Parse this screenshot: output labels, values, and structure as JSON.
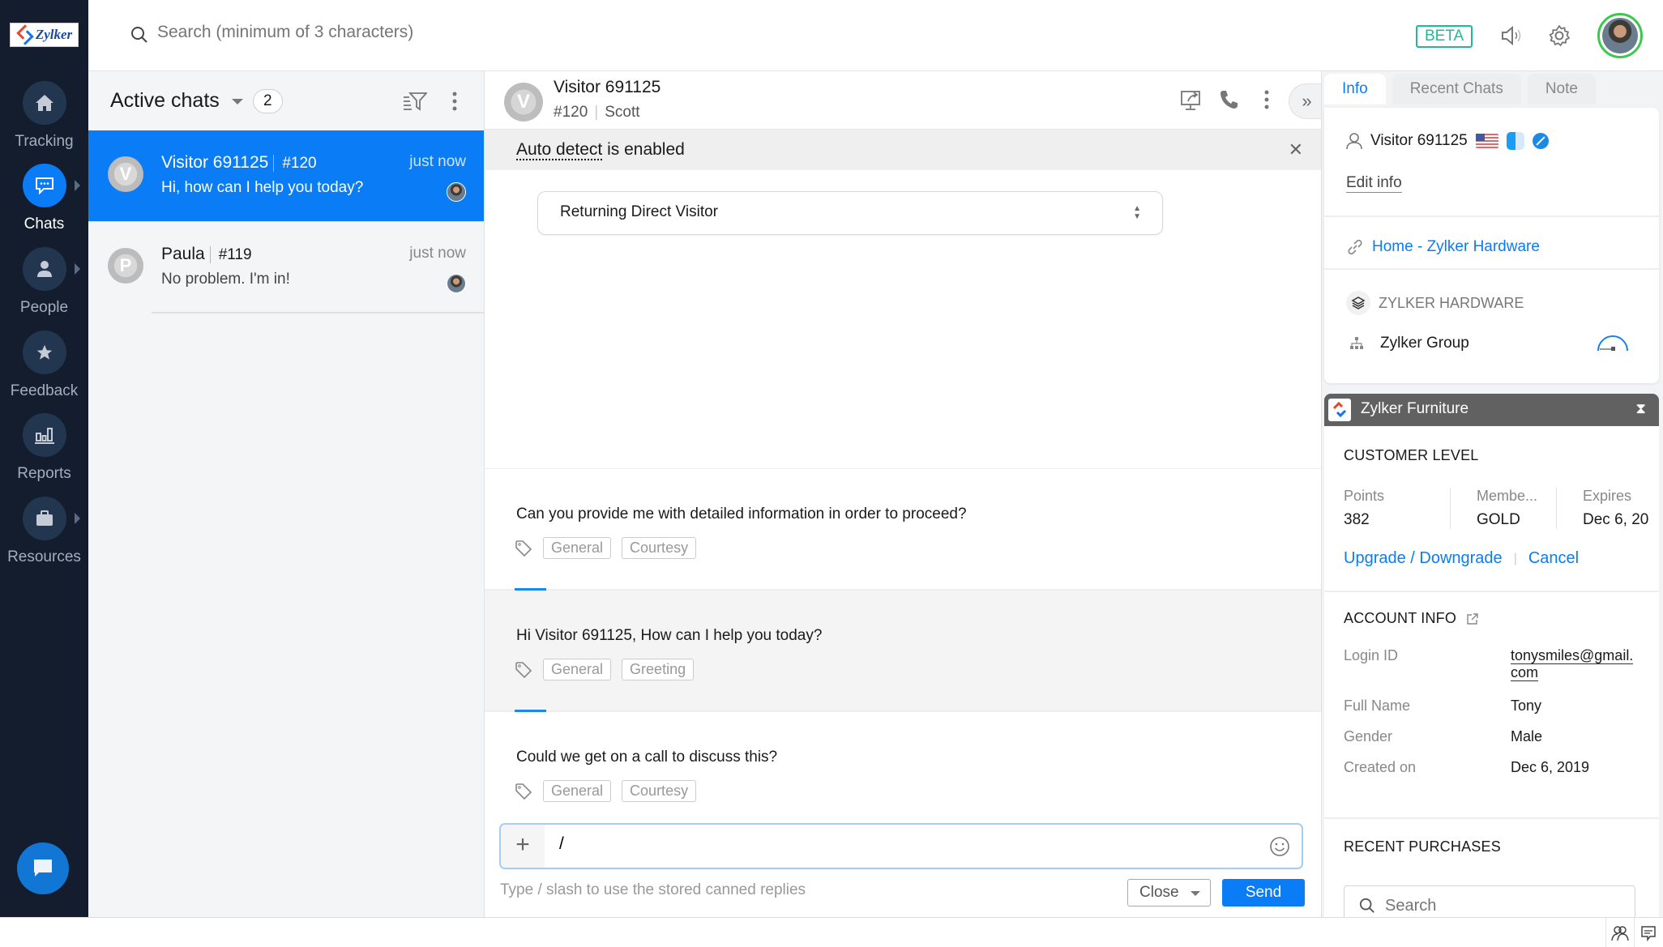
{
  "app": {
    "brand": "Zylker"
  },
  "rail": {
    "items": [
      {
        "label": "Tracking",
        "icon": "home-icon",
        "active": false,
        "has_arrow": false
      },
      {
        "label": "Chats",
        "icon": "chat-bubble-icon",
        "active": true,
        "has_arrow": true
      },
      {
        "label": "People",
        "icon": "person-icon",
        "active": false,
        "has_arrow": true
      },
      {
        "label": "Feedback",
        "icon": "star-icon",
        "active": false,
        "has_arrow": false
      },
      {
        "label": "Reports",
        "icon": "bar-chart-icon",
        "active": false,
        "has_arrow": false
      },
      {
        "label": "Resources",
        "icon": "briefcase-icon",
        "active": false,
        "has_arrow": true
      }
    ]
  },
  "topbar": {
    "search_placeholder": "Search (minimum of 3 characters)",
    "beta_label": "BETA"
  },
  "chat_list": {
    "title": "Active chats",
    "count": "2",
    "items": [
      {
        "initial": "V",
        "name": "Visitor 691125",
        "id": "#120",
        "time": "just now",
        "message": "Hi, how can I help you today?",
        "selected": true
      },
      {
        "initial": "P",
        "name": "Paula",
        "id": "#119",
        "time": "just now",
        "message": "No problem. I'm in!",
        "selected": false
      }
    ]
  },
  "conversation": {
    "visitor_initial": "V",
    "visitor_name": "Visitor 691125",
    "chat_id": "#120",
    "agent": "Scott",
    "notice_link": "Auto detect",
    "notice_rest": " is enabled",
    "visitor_type": "Returning Direct Visitor",
    "expand_label": "»",
    "canned_replies": [
      {
        "text": "Can you provide me with detailed information in order to proceed?",
        "tags": [
          "General",
          "Courtesy"
        ],
        "highlighted": false
      },
      {
        "text": "Hi Visitor 691125, How can I help you today?",
        "tags": [
          "General",
          "Greeting"
        ],
        "highlighted": true
      },
      {
        "text": "Could we get on a call to discuss this?",
        "tags": [
          "General",
          "Courtesy"
        ],
        "highlighted": false
      }
    ],
    "composer_value": "/",
    "composer_hint": "Type / slash to use the stored canned replies",
    "close_label": "Close",
    "send_label": "Send"
  },
  "info_panel": {
    "tabs": [
      {
        "label": "Info",
        "active": true
      },
      {
        "label": "Recent Chats",
        "active": false
      },
      {
        "label": "Note",
        "active": false
      }
    ],
    "visitor_name": "Visitor 691125",
    "edit_label": "Edit info",
    "page_link": "Home - Zylker Hardware",
    "brand": "ZYLKER HARDWARE",
    "department": "Zylker Group",
    "widget": {
      "title": "Zylker Furniture",
      "customer_level_label": "CUSTOMER LEVEL",
      "stats": [
        {
          "label": "Points",
          "value": "382"
        },
        {
          "label": "Membe...",
          "value": "GOLD"
        },
        {
          "label": "Expires",
          "value": "Dec 6, 20"
        }
      ],
      "upgrade_label": "Upgrade / Downgrade",
      "cancel_label": "Cancel",
      "account_info_label": "ACCOUNT INFO",
      "account": [
        {
          "label": "Login ID",
          "value": "tonysmiles@gmail.com"
        },
        {
          "label": "Full Name",
          "value": "Tony"
        },
        {
          "label": "Gender",
          "value": "Male"
        },
        {
          "label": "Created on",
          "value": "Dec 6, 2019"
        }
      ],
      "recent_purchases_label": "RECENT PURCHASES",
      "search_placeholder": "Search"
    }
  },
  "colors": {
    "accent": "#0a7cf5",
    "rail_bg": "#131d2e",
    "beta": "#1ebc96",
    "online": "#3cc84d"
  }
}
